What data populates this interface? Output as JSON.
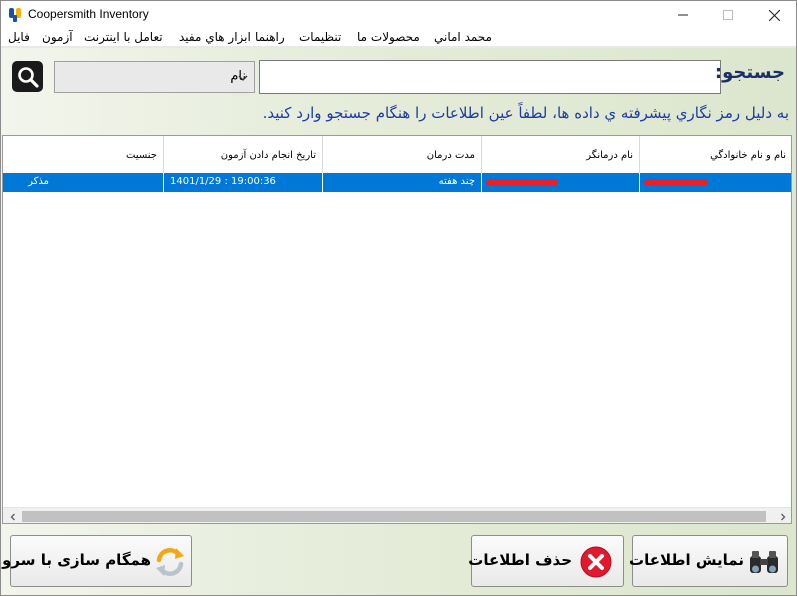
{
  "window": {
    "title": "Coopersmith Inventory"
  },
  "menu": [
    {
      "label": "فایل"
    },
    {
      "label": "آزمون"
    },
    {
      "label": "تعامل با اينترنت"
    },
    {
      "label": "ابزار هاي مفيد"
    },
    {
      "label": "راهنما"
    },
    {
      "label": "تنظيمات"
    },
    {
      "label": "محصولات ما"
    },
    {
      "label": "محمد اماني"
    }
  ],
  "search": {
    "label": "جستجو:",
    "value": "",
    "field_selected": "نام",
    "notice": "به دليل رمز نگاري پيشرفته ي داده ها، لطفاً عين اطلاعات را هنگام جستجو وارد کنيد."
  },
  "table": {
    "columns": [
      "نام و نام خانوادگي",
      "نام درمانگر",
      "مدت درمان",
      "تاريخ انجام دادن آزمون",
      "جنسيت"
    ],
    "rows": [
      {
        "name": "",
        "therapist": "",
        "duration": "چند هفته",
        "test_date": "1401/1/29 : 19:00:36",
        "gender": "مذکر",
        "selected": true
      }
    ]
  },
  "buttons": {
    "show": "نمایش اطلاعات",
    "delete": "حذف اطلاعات",
    "sync": "همگام سازی با سرور"
  },
  "icons": {
    "app": "app-logo-icon",
    "search": "magnifier-icon",
    "show": "binoculars-icon",
    "delete": "delete-x-icon",
    "sync": "sync-arrows-icon"
  },
  "colors": {
    "selection": "#0078d7",
    "notice_text": "#1c3aa8",
    "label_text": "#1b2f66",
    "delete_red": "#e0192f"
  }
}
